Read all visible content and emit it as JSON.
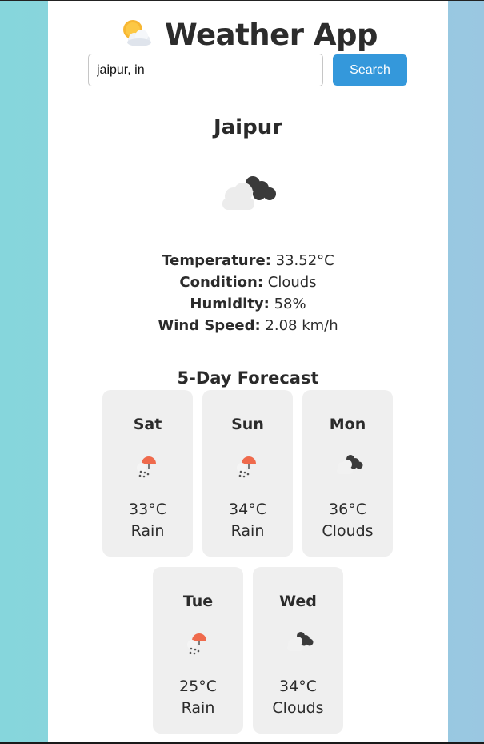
{
  "app": {
    "title": "Weather App",
    "icon": "sun-behind-cloud-icon"
  },
  "search": {
    "value": "jaipur, in",
    "button_label": "Search"
  },
  "current": {
    "city": "Jaipur",
    "icon": "dark-clouds-icon",
    "temperature_label": "Temperature:",
    "temperature_value": "33.52°C",
    "condition_label": "Condition:",
    "condition_value": "Clouds",
    "humidity_label": "Humidity:",
    "humidity_value": "58%",
    "wind_label": "Wind Speed:",
    "wind_value": "2.08 km/h"
  },
  "forecast": {
    "title": "5-Day Forecast",
    "days": [
      {
        "day": "Sat",
        "temp": "33°C",
        "condition": "Rain",
        "icon": "rain-icon"
      },
      {
        "day": "Sun",
        "temp": "34°C",
        "condition": "Rain",
        "icon": "rain-icon"
      },
      {
        "day": "Mon",
        "temp": "36°C",
        "condition": "Clouds",
        "icon": "clouds-icon"
      },
      {
        "day": "Tue",
        "temp": "25°C",
        "condition": "Rain",
        "icon": "rain-icon"
      },
      {
        "day": "Wed",
        "temp": "34°C",
        "condition": "Clouds",
        "icon": "clouds-icon"
      }
    ]
  },
  "colors": {
    "accent": "#3498db",
    "card": "#efefef",
    "text": "#2b2b2b"
  }
}
